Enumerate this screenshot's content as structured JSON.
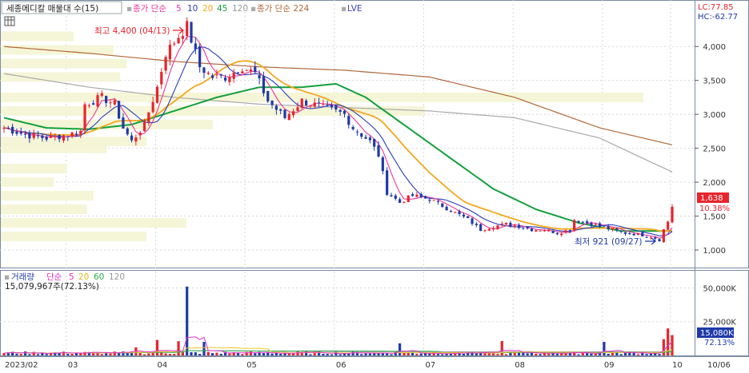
{
  "colors": {
    "up": "#e8242c",
    "down": "#1f3aa8",
    "ma5": "#e6389a",
    "ma10": "#2a3db8",
    "ma20": "#f2a81d",
    "ma45": "#13a03c",
    "ma120": "#a9a9a9",
    "ma224": "#b0673a",
    "lve": "#4040c0",
    "vma5": "#e032c8",
    "vma20": "#e8c830",
    "vma60": "#2aa84a",
    "vma120": "#999999",
    "profile": "#f4f4d4",
    "grid": "#d8d8d8",
    "frame": "#7a8aa0"
  },
  "price_legend": {
    "title": "세종메디칼 매물대 수(15)",
    "ma_prefix": "종가 단순",
    "ma_periods": [
      "5",
      "10",
      "20",
      "45",
      "120"
    ],
    "ma224_label": "종가 단순 224",
    "lve_label": "LVE"
  },
  "lc_hc": {
    "lc": "LC:77.85",
    "hc": "HC:-62.77"
  },
  "annotations": {
    "high": "최고 4,400 (04/13)",
    "low": "최저 921 (09/27)"
  },
  "price_axis": {
    "ticks": [
      "1,000",
      "1,500",
      "2,000",
      "2,500",
      "3,000",
      "3,500",
      "4,000"
    ]
  },
  "current_price": {
    "value": "1,638",
    "change": "10.38%"
  },
  "volume_legend": {
    "title": "거래량",
    "ma_prefix": "단순",
    "ma_periods": [
      "5",
      "20",
      "60",
      "120"
    ],
    "value": "15,079,967주(72.13%)"
  },
  "volume_axis": {
    "ticks": [
      "50,000K",
      "25,000K"
    ]
  },
  "current_volume": {
    "value": "15,080K",
    "change": "72.13%"
  },
  "date_axis": [
    "2023/02",
    "03",
    "04",
    "05",
    "06",
    "07",
    "08",
    "09",
    "10",
    "10/06"
  ],
  "chart_data": {
    "type": "candlestick",
    "price_ylim": [
      800,
      4450
    ],
    "volume_ylim": [
      0,
      55000
    ],
    "high": {
      "value": 4400,
      "date": "04/13"
    },
    "low": {
      "value": 921,
      "date": "09/27"
    },
    "last_close": 1638,
    "last_change_pct": 10.38,
    "last_volume_k": 15080,
    "volume_profile": [
      {
        "price": 3250,
        "weight": 0.97
      },
      {
        "price": 3050,
        "weight": 0.64
      },
      {
        "price": 2850,
        "weight": 0.32
      },
      {
        "price": 2600,
        "weight": 0.22
      },
      {
        "price": 2500,
        "weight": 0.16
      },
      {
        "price": 2200,
        "weight": 0.1
      },
      {
        "price": 2000,
        "weight": 0.08
      },
      {
        "price": 1800,
        "weight": 0.14
      },
      {
        "price": 1600,
        "weight": 0.13
      },
      {
        "price": 1400,
        "weight": 0.28
      },
      {
        "price": 1200,
        "weight": 0.22
      },
      {
        "price": 3550,
        "weight": 0.18
      },
      {
        "price": 3750,
        "weight": 0.19
      },
      {
        "price": 3950,
        "weight": 0.17
      },
      {
        "price": 4150,
        "weight": 0.11
      }
    ],
    "key_closes": [
      [
        0,
        2800
      ],
      [
        5,
        2700
      ],
      [
        10,
        2650
      ],
      [
        15,
        2700
      ],
      [
        18,
        2750
      ],
      [
        19,
        3150
      ],
      [
        23,
        3250
      ],
      [
        26,
        3150
      ],
      [
        28,
        2800
      ],
      [
        30,
        2600
      ],
      [
        33,
        2850
      ],
      [
        36,
        3400
      ],
      [
        38,
        3900
      ],
      [
        41,
        4150
      ],
      [
        43,
        4300
      ],
      [
        46,
        3700
      ],
      [
        49,
        3550
      ],
      [
        52,
        3550
      ],
      [
        56,
        3700
      ],
      [
        59,
        3600
      ],
      [
        62,
        3200
      ],
      [
        66,
        2950
      ],
      [
        70,
        3200
      ],
      [
        75,
        3100
      ],
      [
        80,
        3000
      ],
      [
        82,
        2800
      ],
      [
        86,
        2600
      ],
      [
        88,
        2400
      ],
      [
        90,
        1850
      ],
      [
        93,
        1700
      ],
      [
        96,
        1800
      ],
      [
        100,
        1750
      ],
      [
        103,
        1650
      ],
      [
        106,
        1550
      ],
      [
        109,
        1450
      ],
      [
        112,
        1300
      ],
      [
        115,
        1350
      ],
      [
        118,
        1380
      ],
      [
        121,
        1350
      ],
      [
        124,
        1300
      ],
      [
        127,
        1300
      ],
      [
        130,
        1250
      ],
      [
        133,
        1300
      ],
      [
        134,
        1450
      ],
      [
        137,
        1400
      ],
      [
        140,
        1350
      ],
      [
        143,
        1300
      ],
      [
        146,
        1250
      ],
      [
        149,
        1230
      ],
      [
        152,
        1200
      ],
      [
        154,
        1150
      ],
      [
        155,
        1300
      ],
      [
        156,
        1420
      ],
      [
        157,
        1638
      ]
    ],
    "ma120_path": [
      [
        0,
        3600
      ],
      [
        20,
        3400
      ],
      [
        40,
        3250
      ],
      [
        60,
        3150
      ],
      [
        80,
        3100
      ],
      [
        100,
        3050
      ],
      [
        120,
        2950
      ],
      [
        140,
        2650
      ],
      [
        157,
        2150
      ]
    ],
    "ma224_path": [
      [
        0,
        4000
      ],
      [
        20,
        3900
      ],
      [
        40,
        3780
      ],
      [
        60,
        3700
      ],
      [
        80,
        3650
      ],
      [
        100,
        3550
      ],
      [
        120,
        3250
      ],
      [
        140,
        2800
      ],
      [
        157,
        2550
      ]
    ],
    "ma45_path": [
      [
        0,
        2950
      ],
      [
        10,
        2800
      ],
      [
        20,
        2780
      ],
      [
        30,
        2850
      ],
      [
        40,
        3050
      ],
      [
        50,
        3250
      ],
      [
        60,
        3400
      ],
      [
        70,
        3400
      ],
      [
        78,
        3450
      ],
      [
        85,
        3250
      ],
      [
        95,
        2800
      ],
      [
        105,
        2350
      ],
      [
        115,
        1900
      ],
      [
        125,
        1600
      ],
      [
        135,
        1400
      ],
      [
        145,
        1280
      ],
      [
        157,
        1280
      ]
    ]
  }
}
